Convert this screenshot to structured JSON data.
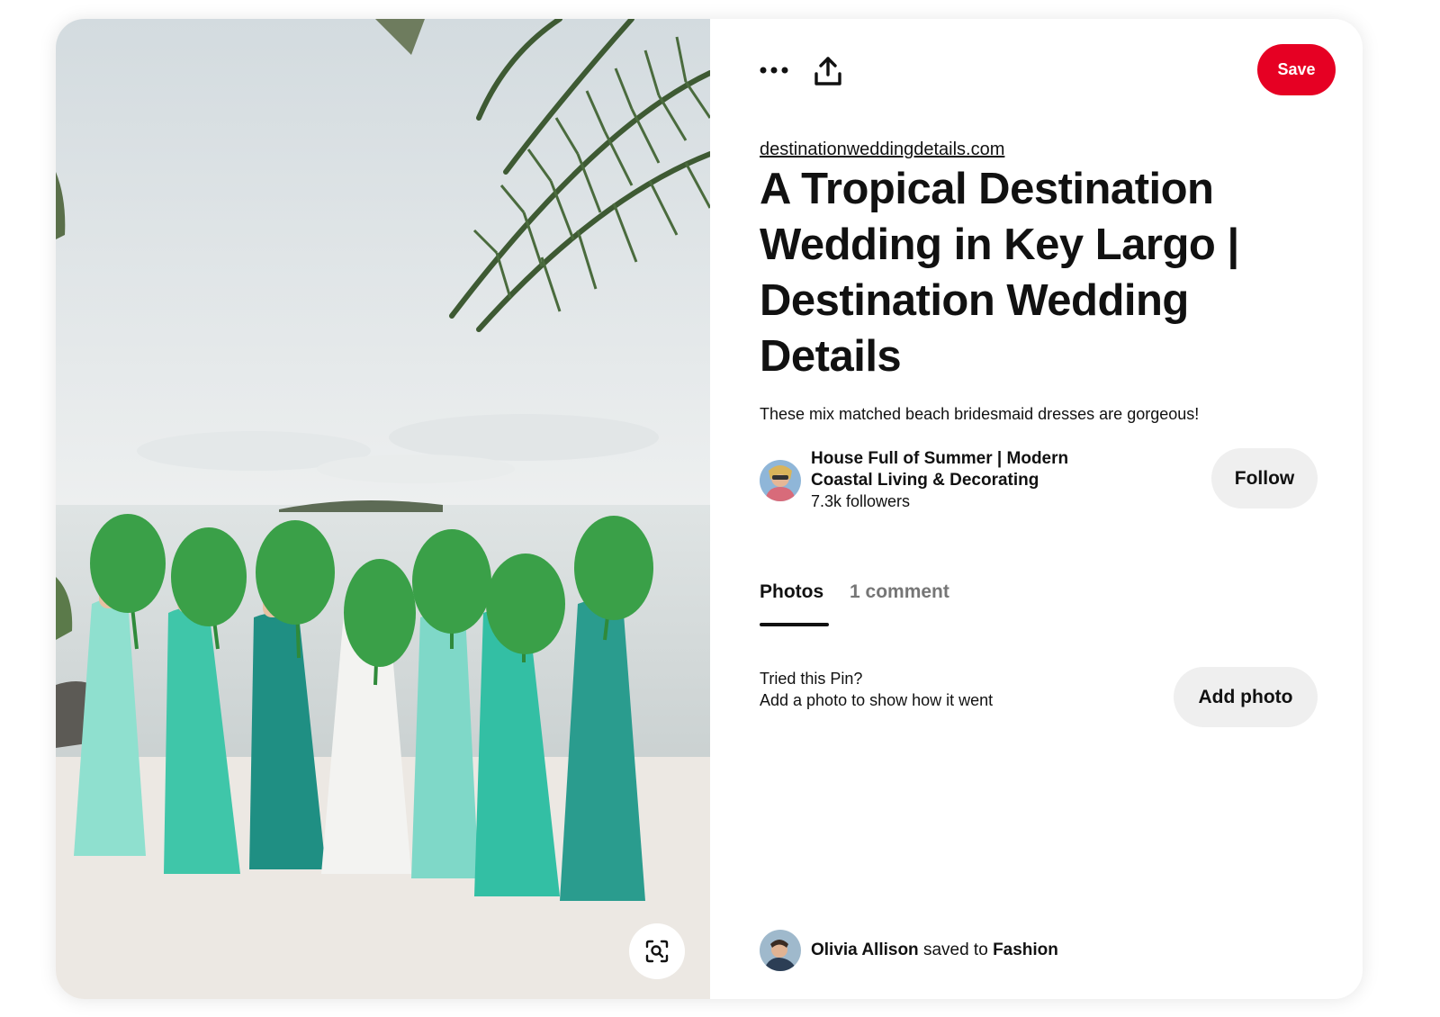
{
  "header": {
    "save_label": "Save",
    "more_icon": "more-horizontal-icon",
    "share_icon": "share-upload-icon"
  },
  "pin": {
    "source_domain": "destinationweddingdetails.com",
    "title": "A Tropical Destination Wedding in Key Largo | Destination Wedding Details",
    "description": "These mix matched beach bridesmaid dresses are gorgeous!",
    "image_icon": "visual-search-icon"
  },
  "creator": {
    "name": "House Full of Summer | Modern Coastal Living & Decorating",
    "followers": "7.3k followers",
    "follow_label": "Follow"
  },
  "tabs": [
    {
      "label": "Photos",
      "active": true
    },
    {
      "label": "1 comment",
      "active": false
    }
  ],
  "tried": {
    "line1": "Tried this Pin?",
    "line2": "Add a photo to show how it went",
    "button_label": "Add photo"
  },
  "saved_by": {
    "user": "Olivia Allison",
    "connector": "saved to",
    "board": "Fashion"
  },
  "colors": {
    "save_red": "#e60023",
    "button_gray": "#efefef",
    "muted_text": "#767676"
  }
}
